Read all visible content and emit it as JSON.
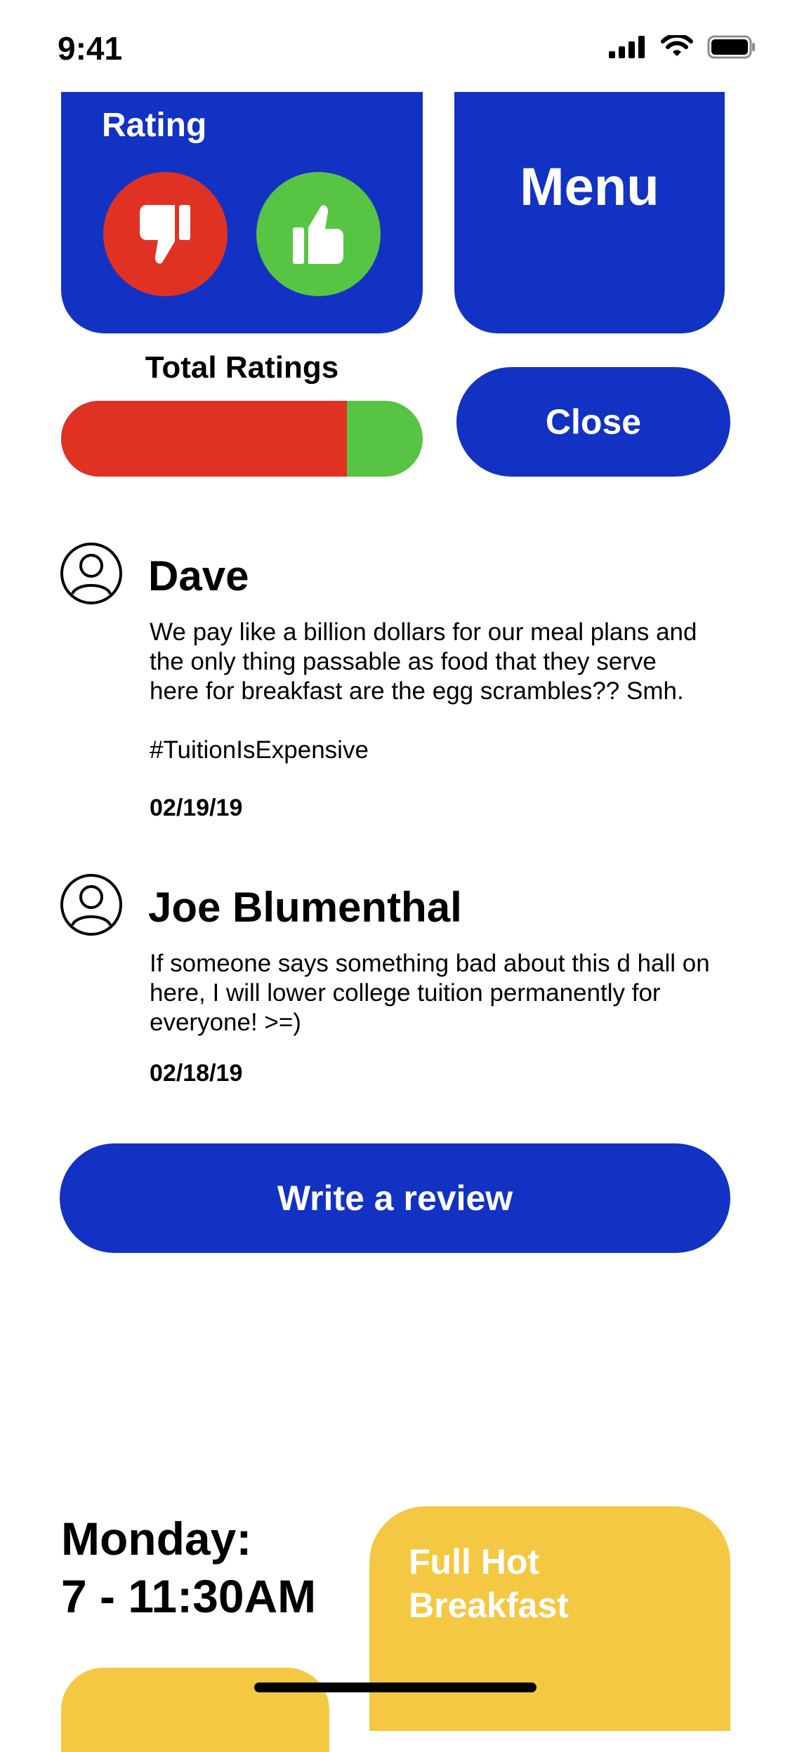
{
  "status_bar": {
    "time": "9:41"
  },
  "rating_card": {
    "title": "Rating"
  },
  "menu_card": {
    "label": "Menu"
  },
  "total_ratings": {
    "label": "Total Ratings",
    "negative_fraction": 0.79,
    "colors": {
      "negative": "#e03223",
      "positive": "#58c443"
    }
  },
  "close_button": {
    "label": "Close"
  },
  "reviews": [
    {
      "name": "Dave",
      "text_lines": [
        "We pay like a billion dollars for our meal plans and",
        "the only thing passable as food that they serve",
        "here for breakfast are the egg scrambles?? Smh."
      ],
      "hashtag": "#TuitionIsExpensive",
      "date": "02/19/19"
    },
    {
      "name": "Joe Blumenthal",
      "text_lines": [
        "If someone says something bad about this d hall on",
        "here, I will lower college tuition permanently for",
        "everyone! >=)"
      ],
      "date": "02/18/19"
    }
  ],
  "write_review_button": {
    "label": "Write a review"
  },
  "hours": {
    "day": "Monday:",
    "time": "7 - 11:30AM"
  },
  "meal_card": {
    "line1": "Full Hot",
    "line2": "Breakfast"
  },
  "colors": {
    "brand_blue": "#1232c4",
    "accent_yellow": "#f4c842"
  },
  "icons": [
    "signal-icon",
    "wifi-icon",
    "battery-icon",
    "thumbs-down-icon",
    "thumbs-up-icon",
    "user-avatar-icon"
  ]
}
